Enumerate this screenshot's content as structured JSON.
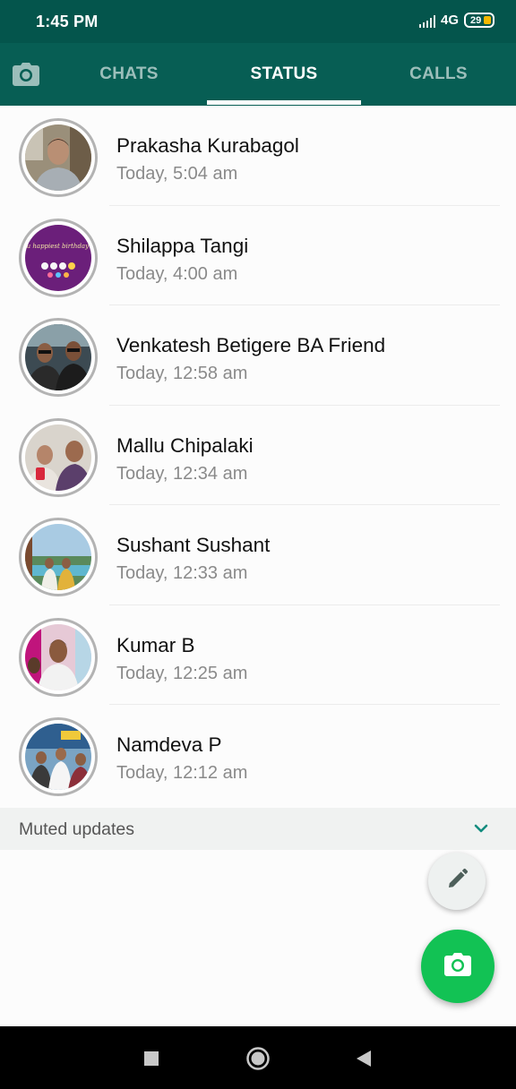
{
  "status_bar": {
    "time": "1:45 PM",
    "network": "4G",
    "battery": "29"
  },
  "tabs": [
    {
      "label": "CHATS",
      "active": false
    },
    {
      "label": "STATUS",
      "active": true
    },
    {
      "label": "CALLS",
      "active": false
    }
  ],
  "statuses": [
    {
      "name": "Prakasha Kurabagol",
      "time": "Today, 5:04 am"
    },
    {
      "name": "Shilappa Tangi",
      "time": "Today, 4:00 am"
    },
    {
      "name": "Venkatesh Betigere BA Friend",
      "time": "Today, 12:58 am"
    },
    {
      "name": "Mallu Chipalaki",
      "time": "Today, 12:34 am"
    },
    {
      "name": "Sushant Sushant",
      "time": "Today, 12:33 am"
    },
    {
      "name": "Kumar B",
      "time": "Today, 12:25 am"
    },
    {
      "name": "Namdeva P",
      "time": "Today, 12:12 am"
    }
  ],
  "avatar_2_text": "Wish you happiest birthday brother",
  "muted_updates": {
    "label": "Muted updates"
  },
  "colors": {
    "header": "#075e54",
    "status_bar": "#04554c",
    "fab": "#12c254",
    "accent": "#128c7e"
  },
  "icons": {
    "camera_tab": "camera-icon",
    "muted_toggle": "chevron-down-icon",
    "fab_text": "pencil-icon",
    "fab_camera": "camera-icon",
    "nav": [
      "square-icon",
      "circle-icon",
      "back-triangle-icon"
    ]
  }
}
